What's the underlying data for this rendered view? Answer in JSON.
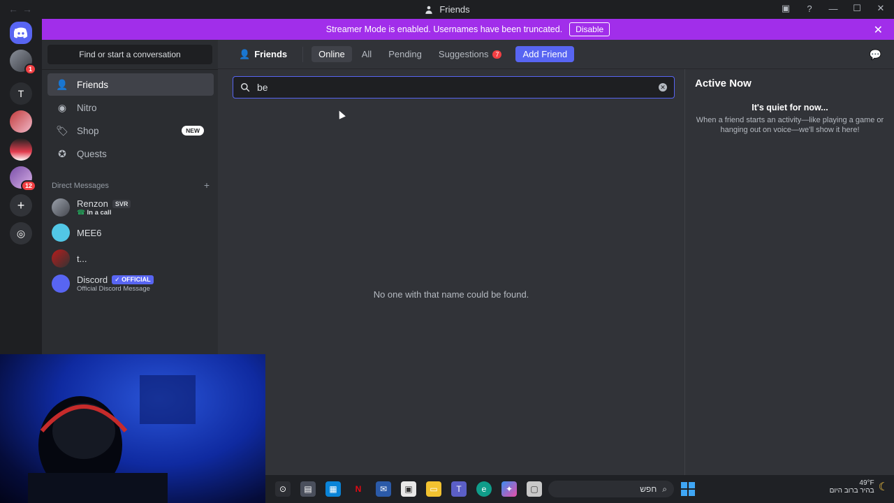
{
  "window": {
    "title": "Friends",
    "nav_back": "←",
    "nav_forward": "→"
  },
  "banner": {
    "text": "Streamer Mode is enabled. Usernames have been truncated.",
    "disable_label": "Disable"
  },
  "guilds": {
    "server_t_label": "T",
    "badge_server1": "1",
    "badge_server_last": "12"
  },
  "sidebar": {
    "search_placeholder": "Find or start a conversation",
    "nav": [
      {
        "label": "Friends",
        "icon": "friends-icon"
      },
      {
        "label": "Nitro",
        "icon": "nitro-icon"
      },
      {
        "label": "Shop",
        "icon": "shop-icon",
        "badge": "NEW"
      },
      {
        "label": "Quests",
        "icon": "quests-icon"
      }
    ],
    "dm_header": "Direct Messages",
    "dms": [
      {
        "name": "Renzon",
        "tag": "SVR",
        "sub": "In a call"
      },
      {
        "name": "MEE6"
      },
      {
        "name": "t..."
      },
      {
        "name": "Discord",
        "tag": "OFFICIAL",
        "sub": "Official Discord Message"
      }
    ]
  },
  "topbar": {
    "title": "Friends",
    "tabs": [
      "Online",
      "All",
      "Pending",
      "Suggestions"
    ],
    "suggestions_count": "7",
    "add_friend": "Add Friend"
  },
  "search": {
    "value": "be"
  },
  "empty_message": "No one with that name could be found.",
  "active_now": {
    "title": "Active Now",
    "quiet_title": "It's quiet for now...",
    "quiet_desc": "When a friend starts an activity—like playing a game or hanging out on voice—we'll show it here!"
  },
  "taskbar": {
    "search_text": "חפש",
    "temperature": "49°F",
    "weather_desc": "בהיר ברוב היום"
  },
  "colors": {
    "accent": "#5865f2",
    "banner": "#a12eea",
    "danger": "#f23f43"
  }
}
